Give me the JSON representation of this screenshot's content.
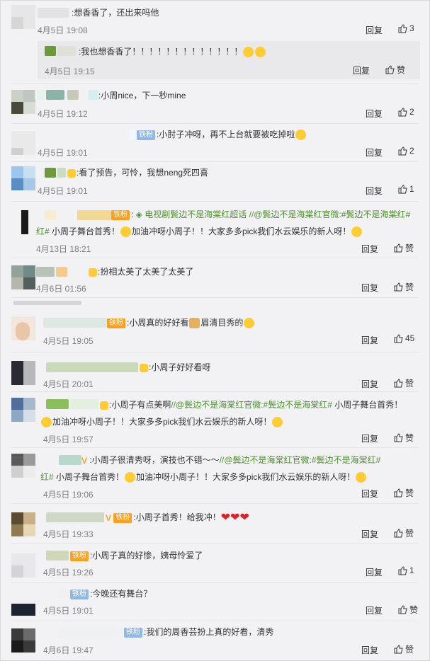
{
  "labels": {
    "reply": "回复",
    "like": "赞"
  },
  "comments": [
    {
      "text": "想香香了，还出来吗他",
      "time": "4月5日 19:08",
      "likes": "3"
    },
    {
      "text": "我也想香香了！！！！！！！！！！！！！",
      "time": "4月5日 19:15",
      "likes": ""
    },
    {
      "text": "小周nice，下一秒mine",
      "time": "4月5日 19:12",
      "likes": "2"
    },
    {
      "badge": "铁粉",
      "text": "小肘子冲呀，再不上台就要被吃掉啦",
      "time": "4月5日 19:01",
      "likes": "2"
    },
    {
      "text": "看了预告，可怜，我想neng死四喜",
      "time": "4月5日 19:01",
      "likes": "1"
    },
    {
      "badge": "铁粉",
      "link1": "电视剧鬓边不是海棠红超话",
      "link2": "//@鬓边不是海棠红官微:",
      "link3": "#鬓边不是海棠红#",
      "text2": "小周子舞台首秀！",
      "text3": "加油冲呀小周子！！大家多多pick我们水云娱乐的新人呀！",
      "time": "4月13日 18:21",
      "likes": ""
    },
    {
      "text": "扮相太美了太美了太美了",
      "time": "4月6日 01:56",
      "likes": ""
    },
    {
      "badge": "铁粉",
      "text": "小周真的好好看",
      "text2": "眉清目秀的",
      "time": "4月5日 19:05",
      "likes": "45"
    },
    {
      "text": "小周子好好看呀",
      "time": "4月5日 20:01",
      "likes": ""
    },
    {
      "text": "小周子有点美啊",
      "link1": "//@鬓边不是海棠红官微:",
      "link2": "#鬓边不是海棠红#",
      "text2": "小周子舞台首秀！",
      "text3": "加油冲呀小周子！！大家多多pick我们水云娱乐的新人呀！",
      "time": "4月5日 19:57",
      "likes": ""
    },
    {
      "vip": "V",
      "text": "小周子很清秀呀，演技也不错～～",
      "link1": "//@鬓边不是海棠红官微:",
      "link2": "#鬓边不是海棠红#",
      "text2": "小周子舞台首秀！",
      "text3": "加油冲呀小周子！！大家多多pick我们水云娱乐的新人呀！",
      "time": "4月5日 19:06",
      "likes": ""
    },
    {
      "vip": "V",
      "badge": "铁粉",
      "text": "小周子首秀！给我冲！",
      "time": "4月5日 19:33",
      "likes": ""
    },
    {
      "badge": "铁粉",
      "text": "小周子真的好惨，姨母怜爱了",
      "time": "4月5日 19:26",
      "likes": "1"
    },
    {
      "badge": "铁粉",
      "text": "今晚还有舞台？",
      "time": "4月5日 19:01",
      "likes": ""
    },
    {
      "badge": "铁粉",
      "text": "我们的周香芸扮上真的好看，清秀",
      "time": "4月6日 19:47",
      "likes": ""
    }
  ]
}
